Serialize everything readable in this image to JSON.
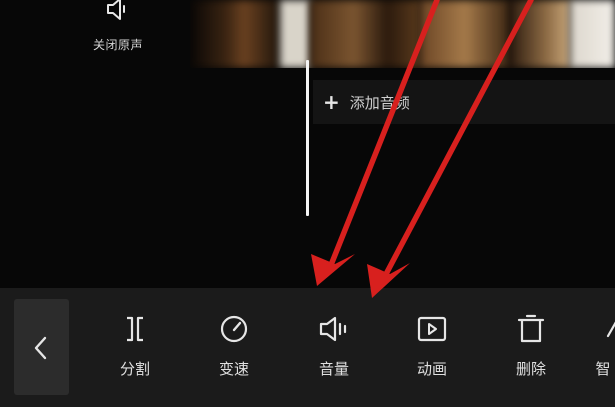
{
  "timeline": {
    "mute_label": "关闭原声",
    "add_audio_label": "添加音频",
    "add_audio_plus": "+"
  },
  "toolbar": {
    "tools": [
      {
        "icon": "split-icon",
        "label": "分割"
      },
      {
        "icon": "speed-icon",
        "label": "变速"
      },
      {
        "icon": "volume-icon",
        "label": "音量"
      },
      {
        "icon": "animation-icon",
        "label": "动画"
      },
      {
        "icon": "delete-icon",
        "label": "删除"
      },
      {
        "icon": "smart-icon",
        "label": "智"
      }
    ]
  },
  "colors": {
    "annotation_arrow": "#d8201e",
    "toolbar_bg": "#1b1b1b",
    "icon": "#e6e6e6"
  }
}
